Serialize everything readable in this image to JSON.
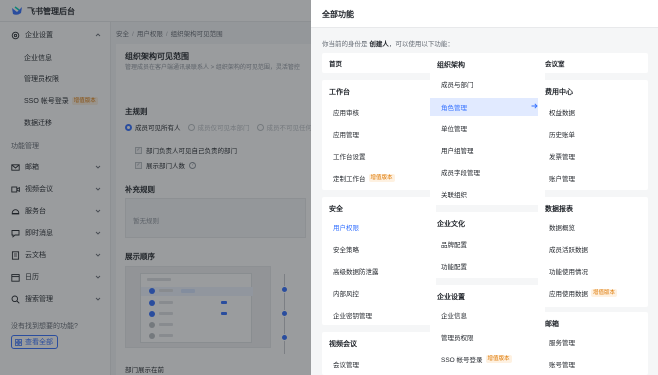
{
  "app": {
    "brand": "飞书管理后台",
    "accent": "#3370ff",
    "tag_color": "#de7802"
  },
  "sidebar": {
    "groups": [
      {
        "label": "企业设置",
        "icon": "gear-icon",
        "expanded": true,
        "children": [
          "企业信息",
          "管理员权限",
          "SSO 帐号登录",
          "数据迁移"
        ],
        "child_tags": {
          "2": "增值版本"
        }
      }
    ],
    "section_label": "功能管理",
    "items": [
      {
        "label": "邮箱",
        "icon": "mail-icon"
      },
      {
        "label": "视频会议",
        "icon": "video-icon"
      },
      {
        "label": "服务台",
        "icon": "service-desk-icon"
      },
      {
        "label": "即时消息",
        "icon": "chat-icon"
      },
      {
        "label": "云文档",
        "icon": "document-icon"
      },
      {
        "label": "日历",
        "icon": "calendar-icon"
      },
      {
        "label": "搜索管理",
        "icon": "search-icon"
      }
    ],
    "help_text": "没有找到想要的功能?",
    "view_all": "查看全部"
  },
  "main": {
    "breadcrumb": [
      "安全",
      "用户权限",
      "组织架构可见范围"
    ],
    "title": "组织架构可见范围",
    "description": "管理成员在客户端通讯录联系人 > 组织架构的可见范围，灵活管控",
    "main_rule_heading": "主规则",
    "radios": [
      {
        "label": "成员可见所有人",
        "checked": true
      },
      {
        "label": "成员仅可见本部门",
        "checked": false
      },
      {
        "label": "成员不可见任何",
        "checked": false
      }
    ],
    "checkboxes": [
      "部门负责人可见自己负责的部门",
      "展示部门人数"
    ],
    "supplement_heading": "补充规则",
    "supplement_placeholder": "暂无规则",
    "order_heading": "展示顺序",
    "preview_caption": "部门展示在前"
  },
  "drawer": {
    "title": "全部功能",
    "subtitle_prefix": "你当前的身份是",
    "role": "创建人",
    "subtitle_suffix": "，可以使用以下功能：",
    "columns": [
      {
        "cards": [
          {
            "items": [
              {
                "label": "首页",
                "bold": true
              }
            ]
          },
          {
            "heading": "工作台",
            "items": [
              {
                "label": "应用审核"
              },
              {
                "label": "应用管理"
              },
              {
                "label": "工作台设置"
              },
              {
                "label": "定制工作台",
                "tag": "增值版本"
              }
            ]
          },
          {
            "heading": "安全",
            "items": [
              {
                "label": "用户权限",
                "selected": true
              },
              {
                "label": "安全策略"
              },
              {
                "label": "高级数据防泄露"
              },
              {
                "label": "内部风控"
              },
              {
                "label": "企业密钥管理"
              }
            ]
          },
          {
            "heading": "视频会议",
            "items": [
              {
                "label": "会议管理"
              }
            ]
          }
        ]
      },
      {
        "cards": [
          {
            "heading": "组织架构",
            "items": [
              {
                "label": "成员与部门"
              },
              {
                "label": "角色管理",
                "active": true
              },
              {
                "label": "单位管理"
              },
              {
                "label": "用户组管理"
              },
              {
                "label": "成员字段管理"
              },
              {
                "label": "关联组织"
              }
            ]
          },
          {
            "heading": "企业文化",
            "items": [
              {
                "label": "品牌配置"
              },
              {
                "label": "功能配置"
              }
            ]
          },
          {
            "heading": "企业设置",
            "items": [
              {
                "label": "企业信息"
              },
              {
                "label": "管理员权限"
              },
              {
                "label": "SSO 帐号登录",
                "tag": "增值版本"
              }
            ]
          }
        ]
      },
      {
        "cards": [
          {
            "items": [
              {
                "label": "会议室",
                "bold": true
              }
            ]
          },
          {
            "heading": "费用中心",
            "items": [
              {
                "label": "权益数据"
              },
              {
                "label": "历史账单"
              },
              {
                "label": "发票管理"
              },
              {
                "label": "账户管理"
              }
            ]
          },
          {
            "heading": "数据报表",
            "items": [
              {
                "label": "数据概览"
              },
              {
                "label": "成员活跃数据"
              },
              {
                "label": "功能使用情况"
              },
              {
                "label": "应用使用数据",
                "tag": "增值版本"
              }
            ]
          },
          {
            "heading": "邮箱",
            "items": [
              {
                "label": "服务管理"
              },
              {
                "label": "账号管理"
              }
            ]
          }
        ]
      }
    ]
  }
}
